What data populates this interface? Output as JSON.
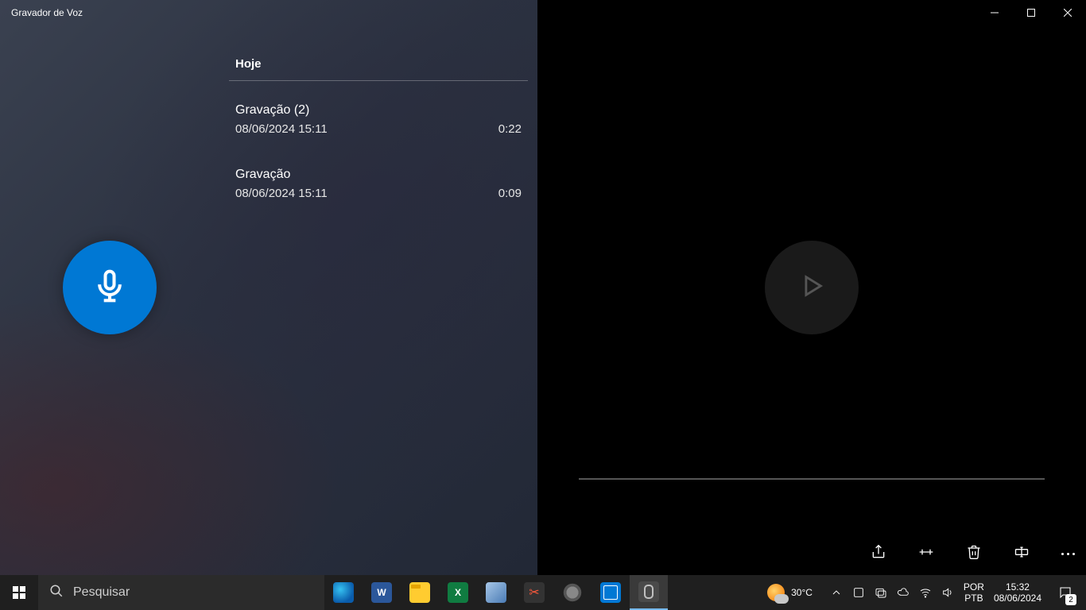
{
  "app": {
    "title": "Gravador de Voz",
    "group_header": "Hoje",
    "recordings": [
      {
        "title": "Gravação (2)",
        "timestamp": "08/06/2024 15:11",
        "duration": "0:22"
      },
      {
        "title": "Gravação",
        "timestamp": "08/06/2024 15:11",
        "duration": "0:09"
      }
    ]
  },
  "taskbar": {
    "search_placeholder": "Pesquisar",
    "weather_temp": "30°C",
    "lang_top": "POR",
    "lang_bottom": "PTB",
    "time": "15:32",
    "date": "08/06/2024",
    "notif_count": "2"
  }
}
